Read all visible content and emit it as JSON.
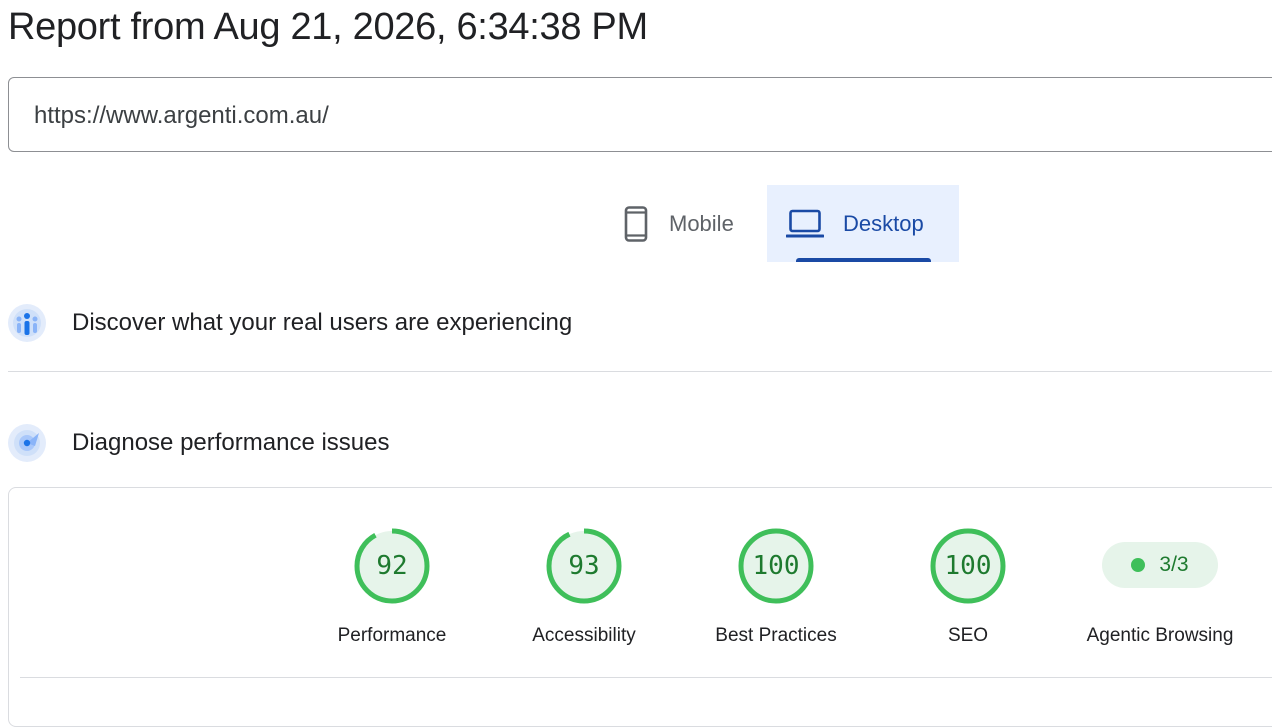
{
  "report": {
    "title": "Report from Aug 21, 2026, 6:34:38 PM"
  },
  "url_field": {
    "value": "https://www.argenti.com.au/"
  },
  "tabs": [
    {
      "label": "Mobile",
      "icon": "smartphone-icon",
      "selected": false
    },
    {
      "label": "Desktop",
      "icon": "laptop-icon",
      "selected": true
    }
  ],
  "sections": {
    "field_data": {
      "label": "Discover what your real users are experiencing",
      "icon": "crux-users-icon"
    },
    "lab_data": {
      "label": "Diagnose performance issues",
      "icon": "lighthouse-icon"
    }
  },
  "scores": [
    {
      "label": "Performance",
      "value": "92",
      "fraction": 0.92
    },
    {
      "label": "Accessibility",
      "value": "93",
      "fraction": 0.93
    },
    {
      "label": "Best Practices",
      "value": "100",
      "fraction": 1.0
    },
    {
      "label": "SEO",
      "value": "100",
      "fraction": 1.0
    }
  ],
  "agentic": {
    "label": "Agentic Browsing",
    "value": "3/3"
  },
  "colors": {
    "pass": "#3fbf5a",
    "pass_text": "#1e7a2f",
    "accent": "#1a4aa5",
    "tab_bg": "#e8f0fe"
  }
}
